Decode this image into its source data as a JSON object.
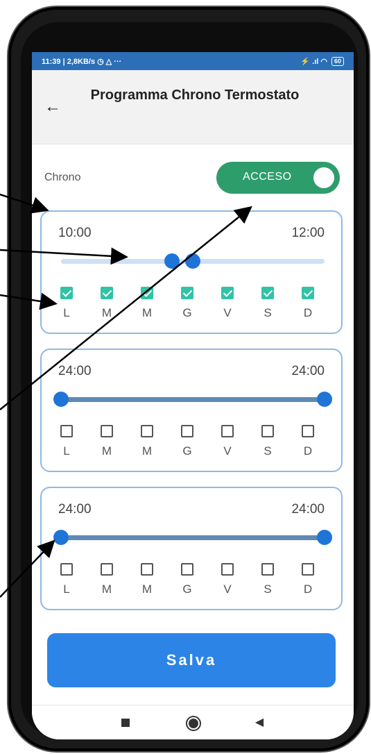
{
  "status_bar": {
    "time_speed": "11:39 | 2,8KB/s ◷ △ ···",
    "icons": "⚡ .ıl ◠",
    "battery": "60"
  },
  "header": {
    "back_icon": "back-arrow-icon",
    "title": "Programma Chrono Termostato"
  },
  "chrono": {
    "label": "Chrono",
    "toggle_label": "ACCESO",
    "toggle_on": true,
    "accent_color": "#2e9d6c"
  },
  "day_labels": [
    "L",
    "M",
    "M",
    "G",
    "V",
    "S",
    "D"
  ],
  "cards": [
    {
      "start": "10:00",
      "end": "12:00",
      "range_start_fraction": 0.42,
      "range_end_fraction": 0.5,
      "days_checked": [
        true,
        true,
        true,
        true,
        true,
        true,
        true
      ]
    },
    {
      "start": "24:00",
      "end": "24:00",
      "range_start_fraction": 0.0,
      "range_end_fraction": 1.0,
      "days_checked": [
        false,
        false,
        false,
        false,
        false,
        false,
        false
      ]
    },
    {
      "start": "24:00",
      "end": "24:00",
      "range_start_fraction": 0.0,
      "range_end_fraction": 1.0,
      "days_checked": [
        false,
        false,
        false,
        false,
        false,
        false,
        false
      ]
    }
  ],
  "save_button": {
    "label": "Salva",
    "color": "#2c84e6"
  },
  "nav": {
    "recent": "square-icon",
    "home": "circle-icon",
    "back": "triangle-back-icon"
  }
}
